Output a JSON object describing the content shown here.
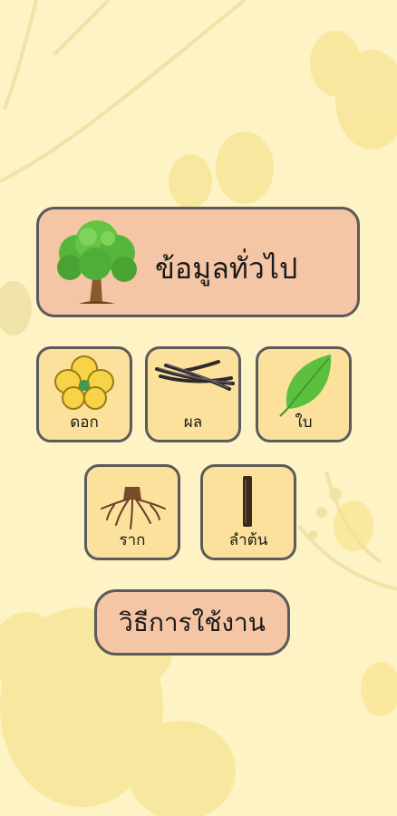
{
  "main": {
    "general_info_label": "ข้อมูลทั่วไป"
  },
  "parts": [
    {
      "label": "ดอก",
      "icon": "flower-icon"
    },
    {
      "label": "ผล",
      "icon": "pod-icon"
    },
    {
      "label": "ใบ",
      "icon": "leaf-icon"
    },
    {
      "label": "ราก",
      "icon": "root-icon"
    },
    {
      "label": "ลำต้น",
      "icon": "trunk-icon"
    }
  ],
  "howto": {
    "label": "วิธีการใช้งาน"
  },
  "colors": {
    "background": "#fdf3c4",
    "card_primary": "#f5c6a5",
    "card_tile": "#fbe19c",
    "border": "#5b5b5b"
  }
}
